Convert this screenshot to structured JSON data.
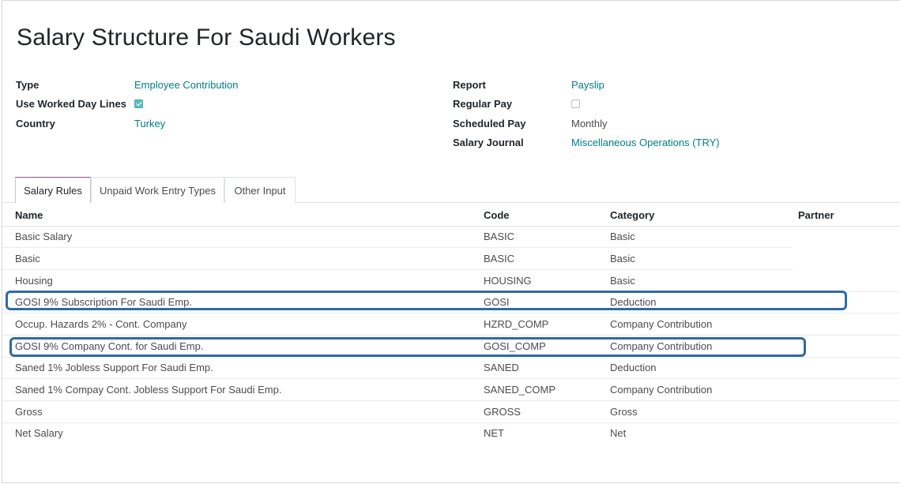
{
  "title": "Salary Structure For Saudi Workers",
  "fields_left": [
    {
      "label": "Type",
      "value": "Employee Contribution"
    },
    {
      "label": "Use Worked Day Lines",
      "checked": true
    },
    {
      "label": "Country",
      "value": "Turkey"
    }
  ],
  "fields_right": [
    {
      "label": "Report",
      "value": "Payslip"
    },
    {
      "label": "Regular Pay",
      "checked": false
    },
    {
      "label": "Scheduled Pay",
      "value": "Monthly"
    },
    {
      "label": "Salary Journal",
      "value": "Miscellaneous Operations (TRY)"
    }
  ],
  "tabs": [
    {
      "label": "Salary Rules",
      "active": true
    },
    {
      "label": "Unpaid Work Entry Types",
      "active": false
    },
    {
      "label": "Other Input",
      "active": false
    }
  ],
  "columns": {
    "name": "Name",
    "code": "Code",
    "category": "Category",
    "partner": "Partner"
  },
  "rows": [
    {
      "name": "Basic Salary",
      "code": "BASIC",
      "category": "Basic"
    },
    {
      "name": "Basic",
      "code": "BASIC",
      "category": "Basic"
    },
    {
      "name": "Housing",
      "code": "HOUSING",
      "category": "Basic"
    },
    {
      "name": "GOSI 9% Subscription For Saudi Emp.",
      "code": "GOSI",
      "category": "Deduction",
      "highlighted": true
    },
    {
      "name": "Occup. Hazards 2% - Cont. Company",
      "code": "HZRD_COMP",
      "category": "Company Contribution"
    },
    {
      "name": "GOSI 9% Company Cont. for Saudi Emp.",
      "code": "GOSI_COMP",
      "category": "Company Contribution",
      "highlighted": true
    },
    {
      "name": "Saned 1% Jobless Support For Saudi Emp.",
      "code": "SANED",
      "category": "Deduction"
    },
    {
      "name": "Saned 1% Compay Cont. Jobless Support For Saudi Emp.",
      "code": "SANED_COMP",
      "category": "Company Contribution"
    },
    {
      "name": "Gross",
      "code": "GROSS",
      "category": "Gross"
    },
    {
      "name": "Net Salary",
      "code": "NET",
      "category": "Net"
    }
  ],
  "colors": {
    "link": "#017e84",
    "highlight_border": "#2f6aa4",
    "active_tab_top": "#8a5a87",
    "checkbox_checked": "#5dbfbf"
  }
}
